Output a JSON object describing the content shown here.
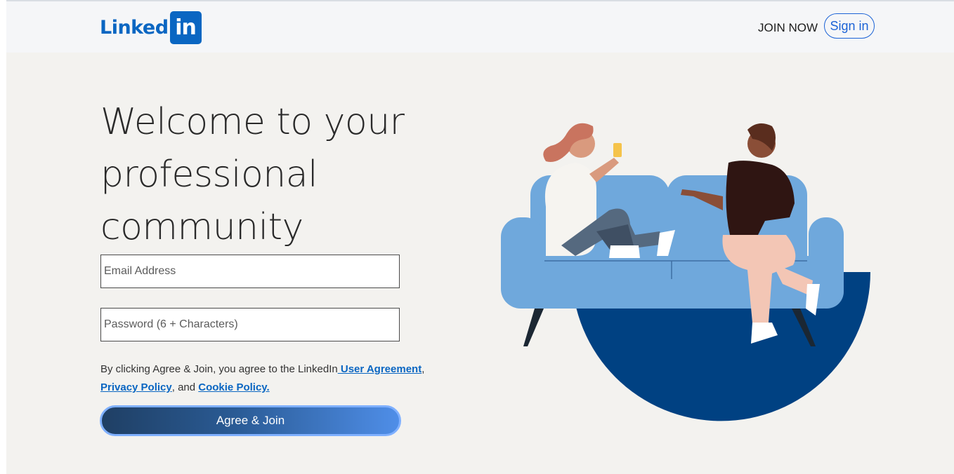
{
  "header": {
    "logo_text": "Linked",
    "logo_box_text": "in",
    "join_now": "JOIN NOW",
    "sign_in": "Sign in"
  },
  "hero": {
    "line1": "Welcome to your",
    "line2": "professional",
    "line3": "community"
  },
  "form": {
    "email_placeholder": "Email Address",
    "password_placeholder": "Password (6 + Characters)",
    "terms_prefix": "By clicking Agree & Join, you agree to the LinkedIn",
    "user_agreement": " User Agreement",
    "comma": ",",
    "privacy_policy": "Privacy Policy",
    "and": ", and ",
    "cookie_policy": "Cookie Policy.",
    "agree_button": "Agree & Join"
  },
  "colors": {
    "brand": "#0a66c2",
    "background": "#f3f2ef",
    "sofa": "#6fa8dc",
    "circle": "#004182"
  }
}
